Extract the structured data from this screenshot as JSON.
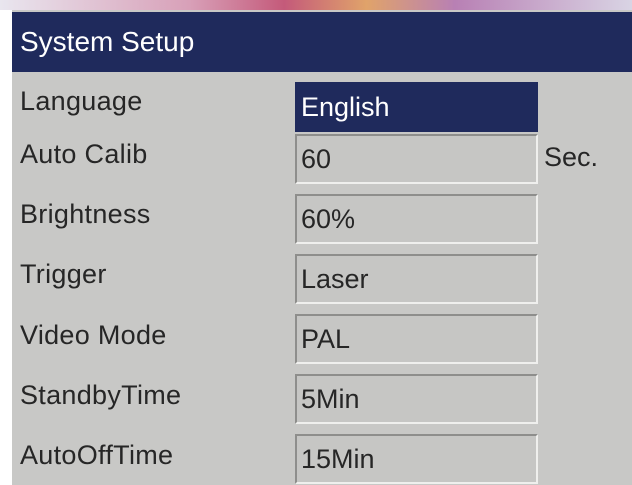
{
  "title": "System Setup",
  "settings": [
    {
      "label": "Language",
      "value": "English"
    },
    {
      "label": "Auto Calib",
      "value": "60",
      "unit": "Sec."
    },
    {
      "label": "Brightness",
      "value": "60%"
    },
    {
      "label": "Trigger",
      "value": "Laser"
    },
    {
      "label": "Video Mode",
      "value": "PAL"
    },
    {
      "label": "StandbyTime",
      "value": "5Min"
    },
    {
      "label": "AutoOffTime",
      "value": "15Min"
    }
  ],
  "colors": {
    "title_bar": "#1f2a5c",
    "panel": "#c8c8c6",
    "selected_field": "#1f2a5c"
  }
}
